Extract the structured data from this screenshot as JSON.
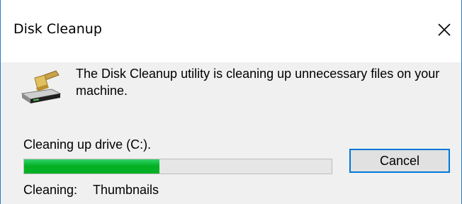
{
  "window": {
    "title": "Disk Cleanup",
    "close_icon": "close-icon"
  },
  "main": {
    "icon": "disk-cleanup-icon",
    "message": "The Disk Cleanup utility is cleaning up unnecessary files on your machine.",
    "status": "Cleaning up drive  (C:).",
    "progress": 0.44,
    "cancel_label": "Cancel",
    "cleaning_label": "Cleaning:",
    "cleaning_item": "Thumbnails"
  },
  "colors": {
    "progress_fill": "#06b025",
    "accent_border": "#0078d7"
  }
}
